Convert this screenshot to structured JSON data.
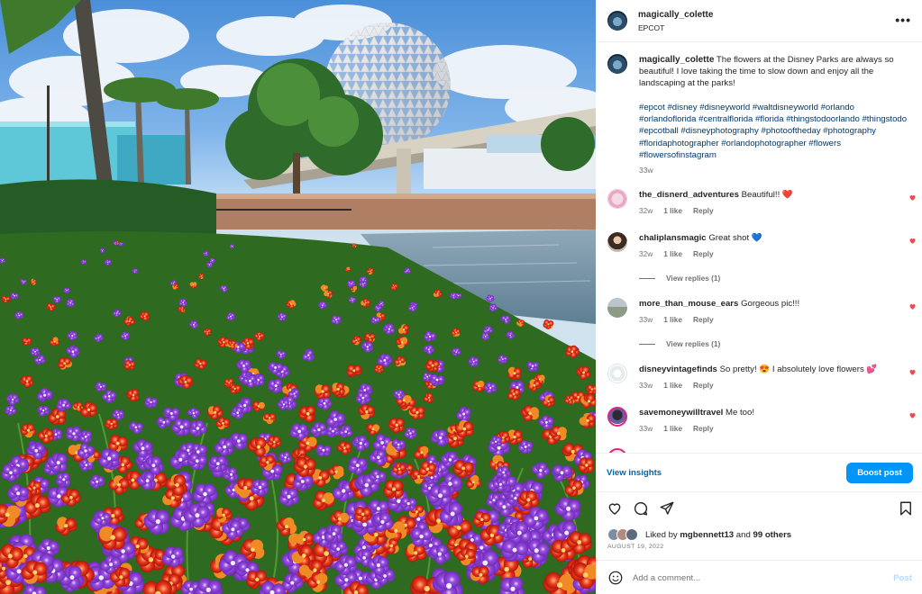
{
  "post": {
    "username": "magically_colette",
    "location": "EPCOT",
    "more_icon": "more-horizontal-icon"
  },
  "caption": {
    "username": "magically_colette",
    "text": "The flowers at the Disney Parks are always so beautiful! I love taking the time to slow down and enjoy all the landscaping at the parks!",
    "hashtags": "#epcot #disney #disneyworld #waltdisneyworld #orlando #orlandoflorida #centralflorida #florida #thingstodoorlando #thingstodo #epcotball #disneyphotography #photooftheday #photography #floridaphotographer #orlandophotographer #flowers #flowersofinstagram",
    "time": "33w"
  },
  "comments": [
    {
      "username": "the_disnerd_adventures",
      "text": "Beautiful!! ❤️",
      "time": "32w",
      "likes": "1 like",
      "reply": "Reply"
    },
    {
      "username": "chaliplansmagic",
      "text": "Great shot 💙",
      "time": "32w",
      "likes": "1 like",
      "reply": "Reply",
      "view_replies": "View replies (1)"
    },
    {
      "username": "more_than_mouse_ears",
      "text": "Gorgeous pic!!!",
      "time": "33w",
      "likes": "1 like",
      "reply": "Reply",
      "view_replies": "View replies (1)"
    },
    {
      "username": "disneyvintagefinds",
      "text": "So pretty! 😍 I absolutely love flowers 💕",
      "time": "33w",
      "likes": "1 like",
      "reply": "Reply"
    },
    {
      "username": "savemoneywilltravel",
      "text": "Me too!",
      "time": "33w",
      "likes": "1 like",
      "reply": "Reply"
    }
  ],
  "insights": {
    "view_label": "View insights",
    "boost_label": "Boost post"
  },
  "actions": {
    "icons": [
      "heart-icon",
      "comment-icon",
      "share-icon",
      "bookmark-icon"
    ]
  },
  "likes": {
    "prefix": "Liked by",
    "user": "mgbennett13",
    "joiner": "and",
    "others": "99 others"
  },
  "date": "AUGUST 19, 2022",
  "add_comment": {
    "placeholder": "Add a comment...",
    "post_label": "Post"
  },
  "colors": {
    "link": "#00376b",
    "accent": "#0095f6",
    "heart": "#ed4956",
    "muted": "#737373"
  }
}
